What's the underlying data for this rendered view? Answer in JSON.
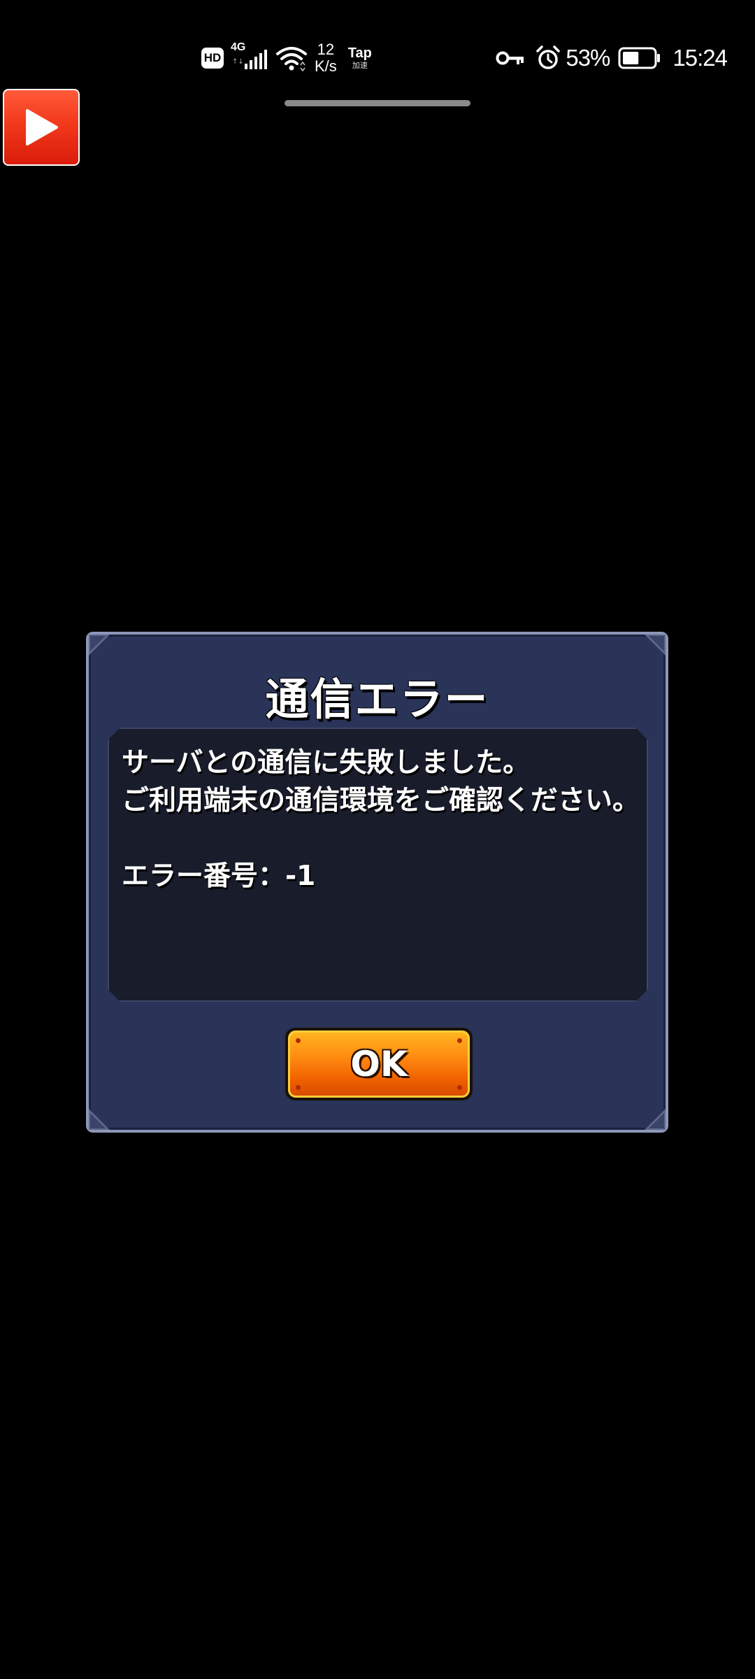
{
  "status_bar": {
    "hd": "HD",
    "network": "4G",
    "speed_value": "12",
    "speed_unit": "K/s",
    "tap_label": "Tap",
    "tap_sub": "加速",
    "battery_percent": "53%",
    "battery_level": 0.53,
    "time": "15:24"
  },
  "dialog": {
    "title": "通信エラー",
    "message_line1": "サーバとの通信に失敗しました。",
    "message_line2": "ご利用端末の通信環境をご確認ください。",
    "error_line": "エラー番号：-1",
    "ok_label": "OK"
  },
  "colors": {
    "background": "#000000",
    "dialog_bg": "#2a3358",
    "message_bg": "#181c2b",
    "ok_button": "#ff8a10",
    "play_button": "#f2391c"
  },
  "icons": {
    "play": "play-icon",
    "wifi": "wifi-icon",
    "key": "vpn-key-icon",
    "alarm": "alarm-icon",
    "battery": "battery-icon"
  }
}
